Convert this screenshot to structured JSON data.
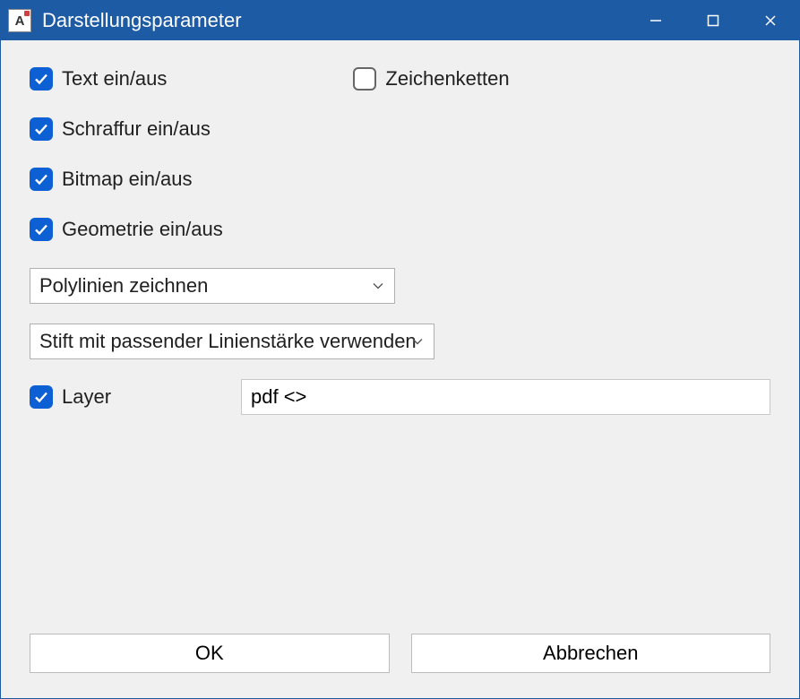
{
  "window": {
    "title": "Darstellungsparameter",
    "app_icon_letter": "A"
  },
  "checkboxes": {
    "text": {
      "label": "Text ein/aus",
      "checked": true
    },
    "zeichenketten": {
      "label": "Zeichenketten",
      "checked": false
    },
    "schraffur": {
      "label": "Schraffur ein/aus",
      "checked": true
    },
    "bitmap": {
      "label": "Bitmap ein/aus",
      "checked": true
    },
    "geometrie": {
      "label": "Geometrie ein/aus",
      "checked": true
    },
    "layer": {
      "label": "Layer",
      "checked": true
    }
  },
  "combos": {
    "polylinien": "Polylinien zeichnen",
    "stift": "Stift mit passender Linienstärke verwenden"
  },
  "inputs": {
    "layer_value": "pdf <>"
  },
  "buttons": {
    "ok": "OK",
    "cancel": "Abbrechen"
  },
  "colors": {
    "titlebar": "#1e5ba5",
    "accent": "#0d5fd4",
    "client_bg": "#f0f0f0"
  }
}
